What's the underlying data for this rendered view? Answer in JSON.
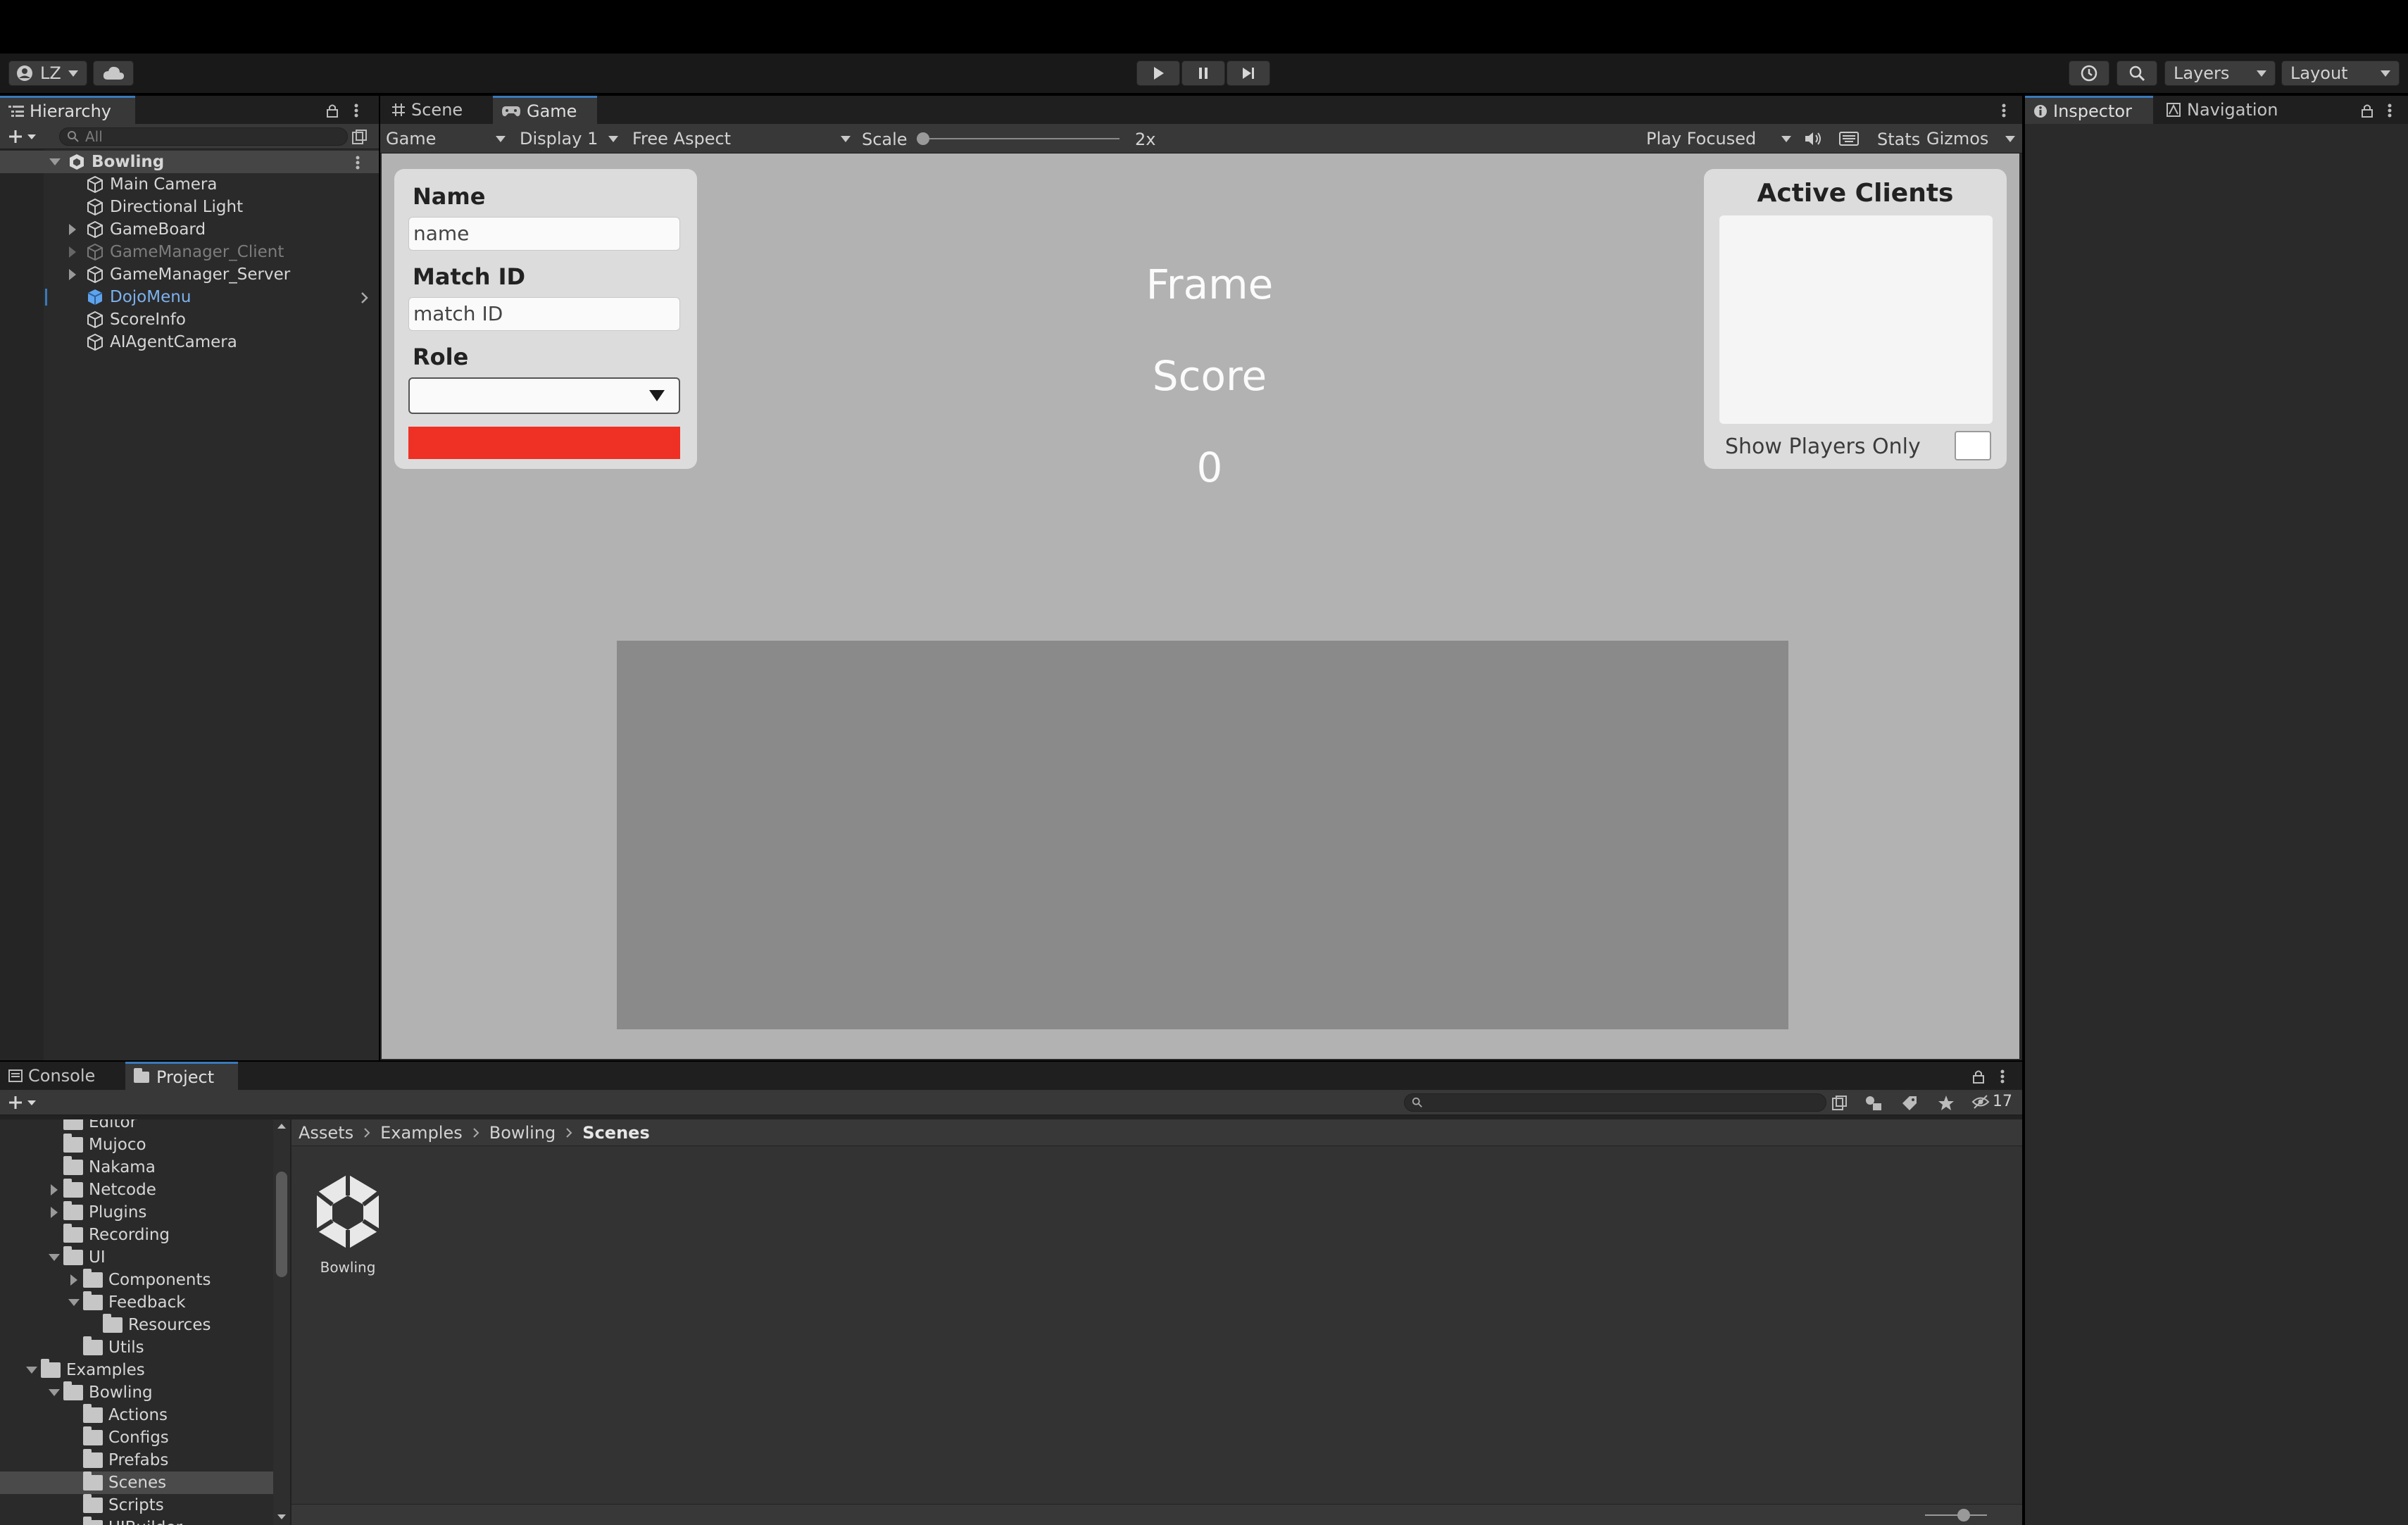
{
  "toolbar": {
    "account_label": "LZ",
    "layers_label": "Layers",
    "layout_label": "Layout",
    "icons": [
      "account-icon",
      "cloud-icon",
      "play-icon",
      "pause-icon",
      "step-icon",
      "history-icon",
      "search-icon"
    ]
  },
  "hierarchy": {
    "tab_label": "Hierarchy",
    "search_placeholder": "All",
    "scene_name": "Bowling",
    "items": [
      {
        "label": "Main Camera"
      },
      {
        "label": "Directional Light"
      },
      {
        "label": "GameBoard"
      },
      {
        "label": "GameManager_Client"
      },
      {
        "label": "GameManager_Server"
      },
      {
        "label": "DojoMenu"
      },
      {
        "label": "ScoreInfo"
      },
      {
        "label": "AIAgentCamera"
      }
    ]
  },
  "game_tabs": {
    "scene_label": "Scene",
    "game_label": "Game"
  },
  "game_toolbar": {
    "view_mode": "Game",
    "display": "Display 1",
    "aspect": "Free Aspect",
    "scale_label": "Scale",
    "scale_value": "2x",
    "scale_level": 0.0,
    "play_mode": "Play Focused",
    "stats_label": "Stats",
    "gizmos_label": "Gizmos"
  },
  "game_ui": {
    "name_heading": "Name",
    "name_placeholder": "name",
    "match_heading": "Match ID",
    "match_placeholder": "match ID",
    "role_heading": "Role",
    "role_value": "",
    "action_button_color": "#ee3124",
    "frame_label": "Frame",
    "score_label": "Score",
    "score_value": "0",
    "clients_heading": "Active Clients",
    "show_players_label": "Show Players Only",
    "show_players_checked": false
  },
  "inspector": {
    "tab_inspector": "Inspector",
    "tab_navigation": "Navigation"
  },
  "bottom_tabs": {
    "console_label": "Console",
    "project_label": "Project",
    "hidden_count": "17"
  },
  "project_tree": [
    {
      "label": "Editor"
    },
    {
      "label": "Mujoco"
    },
    {
      "label": "Nakama"
    },
    {
      "label": "Netcode"
    },
    {
      "label": "Plugins"
    },
    {
      "label": "Recording"
    },
    {
      "label": "UI"
    },
    {
      "label": "Components"
    },
    {
      "label": "Feedback"
    },
    {
      "label": "Resources"
    },
    {
      "label": "Utils"
    },
    {
      "label": "Examples"
    },
    {
      "label": "Bowling"
    },
    {
      "label": "Actions"
    },
    {
      "label": "Configs"
    },
    {
      "label": "Prefabs"
    },
    {
      "label": "Scenes"
    },
    {
      "label": "Scripts"
    },
    {
      "label": "UIBuilder"
    }
  ],
  "breadcrumb": [
    "Assets",
    "Examples",
    "Bowling",
    "Scenes"
  ],
  "assets": [
    {
      "label": "Bowling"
    }
  ],
  "colors": {
    "accent": "#3a79bb",
    "selected_object": "#7cb2ef",
    "disabled_object": "#7c7c7c"
  }
}
